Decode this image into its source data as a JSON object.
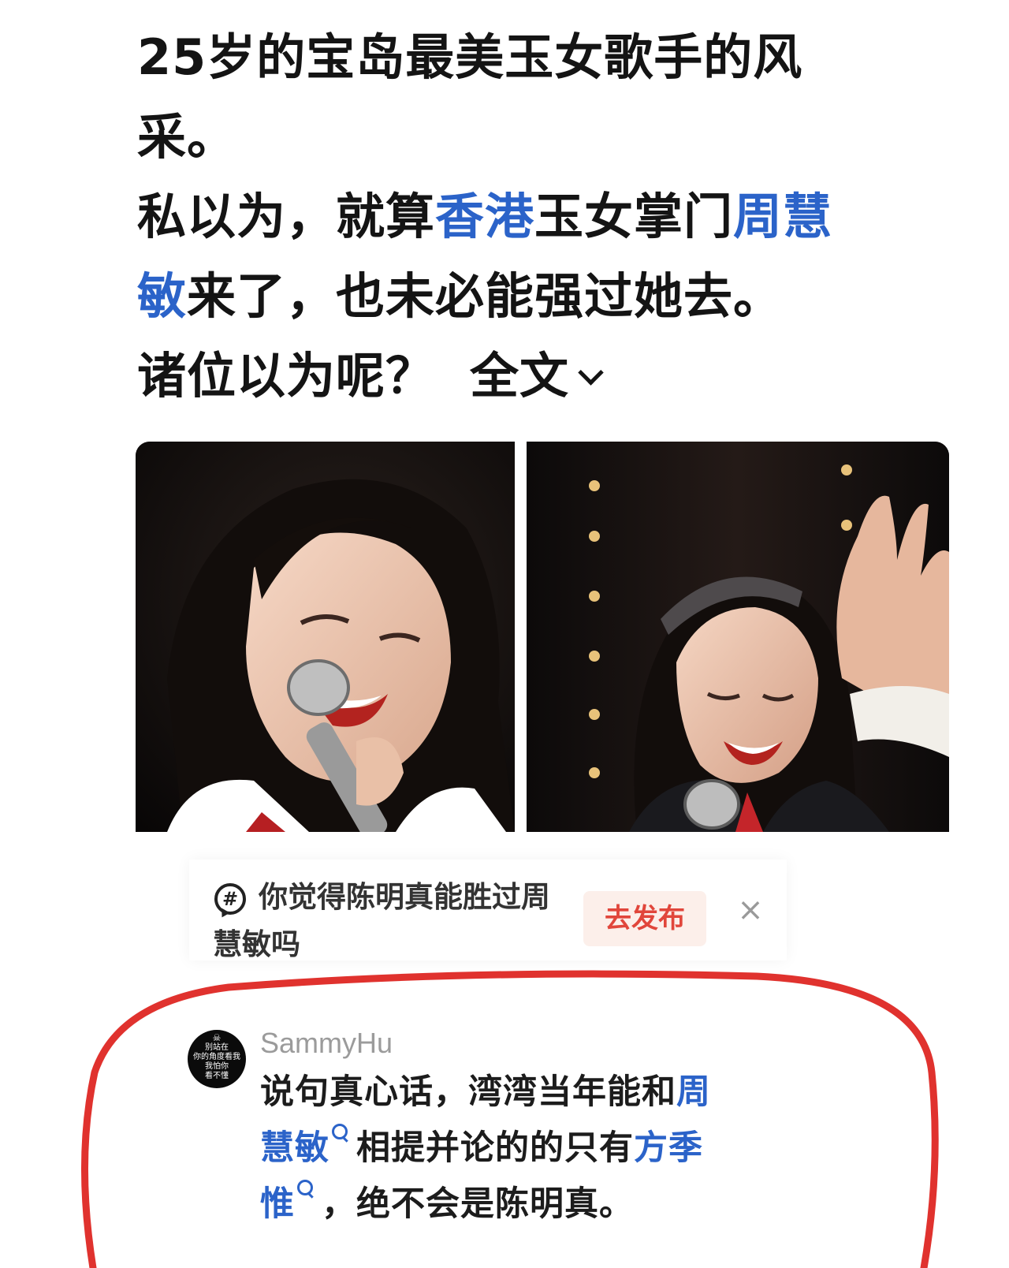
{
  "post": {
    "line1": "25岁的宝岛最美玉女歌手的风",
    "line2": "采。",
    "line3_a": "私以为，就算",
    "line3_link1": "香港",
    "line3_b": "玉女掌门",
    "line3_link2": "周慧",
    "line4_link": "敏",
    "line4_b": "来了，也未必能强过她去。",
    "line5": "诸位以为呢？",
    "expand_label": "全文"
  },
  "photos": [
    {
      "name": "photo-singer-1",
      "icon": "photo-singing-woman"
    },
    {
      "name": "photo-singer-2",
      "icon": "photo-smiling-woman"
    }
  ],
  "topic": {
    "icon_glyph": "#",
    "text": "你觉得陈明真能胜过周慧敏吗",
    "publish_label": "去发布",
    "close_glyph": "×"
  },
  "comment": {
    "avatar_lines": [
      "别站在",
      "你的角度看我",
      "我怕你",
      "看不懂"
    ],
    "username": "SammyHu",
    "line1_a": "说句真心话，湾湾当年能和",
    "line1_link": "周",
    "line2_link": "慧敏",
    "line2_b": "相提并论的的只有",
    "line2_link2": "方季",
    "line3_link": "惟",
    "line3_b": "，绝不会是陈明真。"
  },
  "colors": {
    "link": "#2b63c9",
    "annotation_circle": "#e0322e",
    "publish_text": "#e1463b",
    "publish_bg": "#fcefea"
  }
}
